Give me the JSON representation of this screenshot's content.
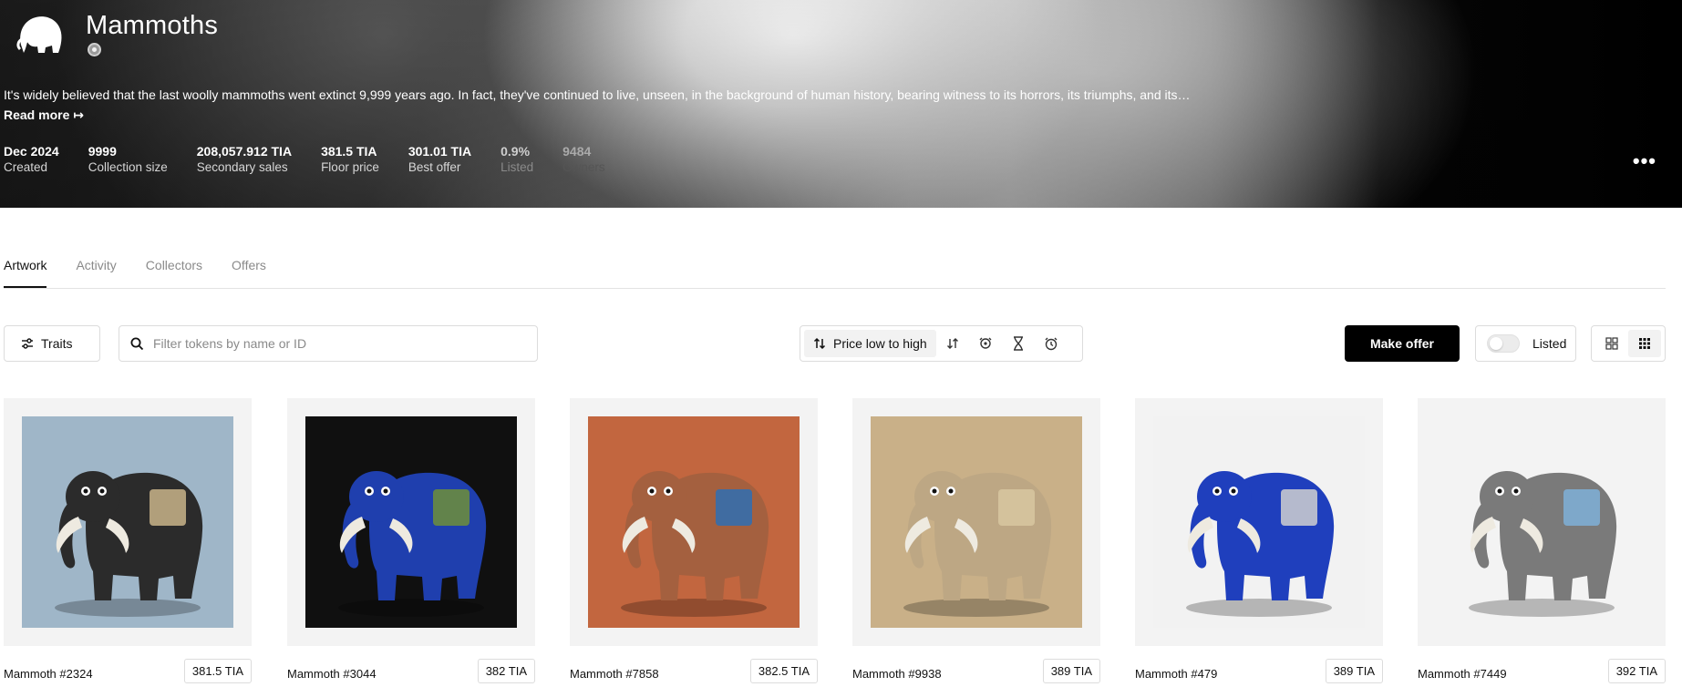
{
  "collection": {
    "title": "Mammoths",
    "description": "It's widely believed that the last woolly mammoths went extinct 9,999 years ago. In fact, they've continued to live, unseen, in the background of human history, bearing witness to its horrors, its triumphs, and its…",
    "read_more": "Read more ↦",
    "stats": [
      {
        "value": "Dec 2024",
        "label": "Created"
      },
      {
        "value": "9999",
        "label": "Collection size"
      },
      {
        "value": "208,057.912 TIA",
        "label": "Secondary sales"
      },
      {
        "value": "381.5 TIA",
        "label": "Floor price"
      },
      {
        "value": "301.01 TIA",
        "label": "Best offer"
      },
      {
        "value": "0.9%",
        "label": "Listed"
      },
      {
        "value": "9484",
        "label": "Owners"
      }
    ],
    "more_label": "•••"
  },
  "tabs": [
    {
      "label": "Artwork",
      "active": true
    },
    {
      "label": "Activity"
    },
    {
      "label": "Collectors"
    },
    {
      "label": "Offers"
    }
  ],
  "toolbar": {
    "traits_label": "Traits",
    "search_placeholder": "Filter tokens by name or ID",
    "sort_label": "Price low to high",
    "make_offer_label": "Make offer",
    "listed_label": "Listed"
  },
  "tokens": [
    {
      "name": "Mammoth #2324",
      "price": "381.5 TIA",
      "bg": "#9fb6c8",
      "body": "#2b2b2b",
      "accent": "#c9b48a"
    },
    {
      "name": "Mammoth #3044",
      "price": "382 TIA",
      "bg": "#101010",
      "body": "#1f3fae",
      "accent": "#6e8f3a"
    },
    {
      "name": "Mammoth #7858",
      "price": "382.5 TIA",
      "bg": "#c2663f",
      "body": "#a4603f",
      "accent": "#2f6fb3"
    },
    {
      "name": "Mammoth #9938",
      "price": "389 TIA",
      "bg": "#c9b088",
      "body": "#bda784",
      "accent": "#d8c7a0"
    },
    {
      "name": "Mammoth #479",
      "price": "389 TIA",
      "bg": "#f2f2f2",
      "body": "#1f3fbd",
      "accent": "#d0d0d0"
    },
    {
      "name": "Mammoth #7449",
      "price": "392 TIA",
      "bg": "#f3f3f3",
      "body": "#7a7a7a",
      "accent": "#7fb0d8"
    }
  ]
}
